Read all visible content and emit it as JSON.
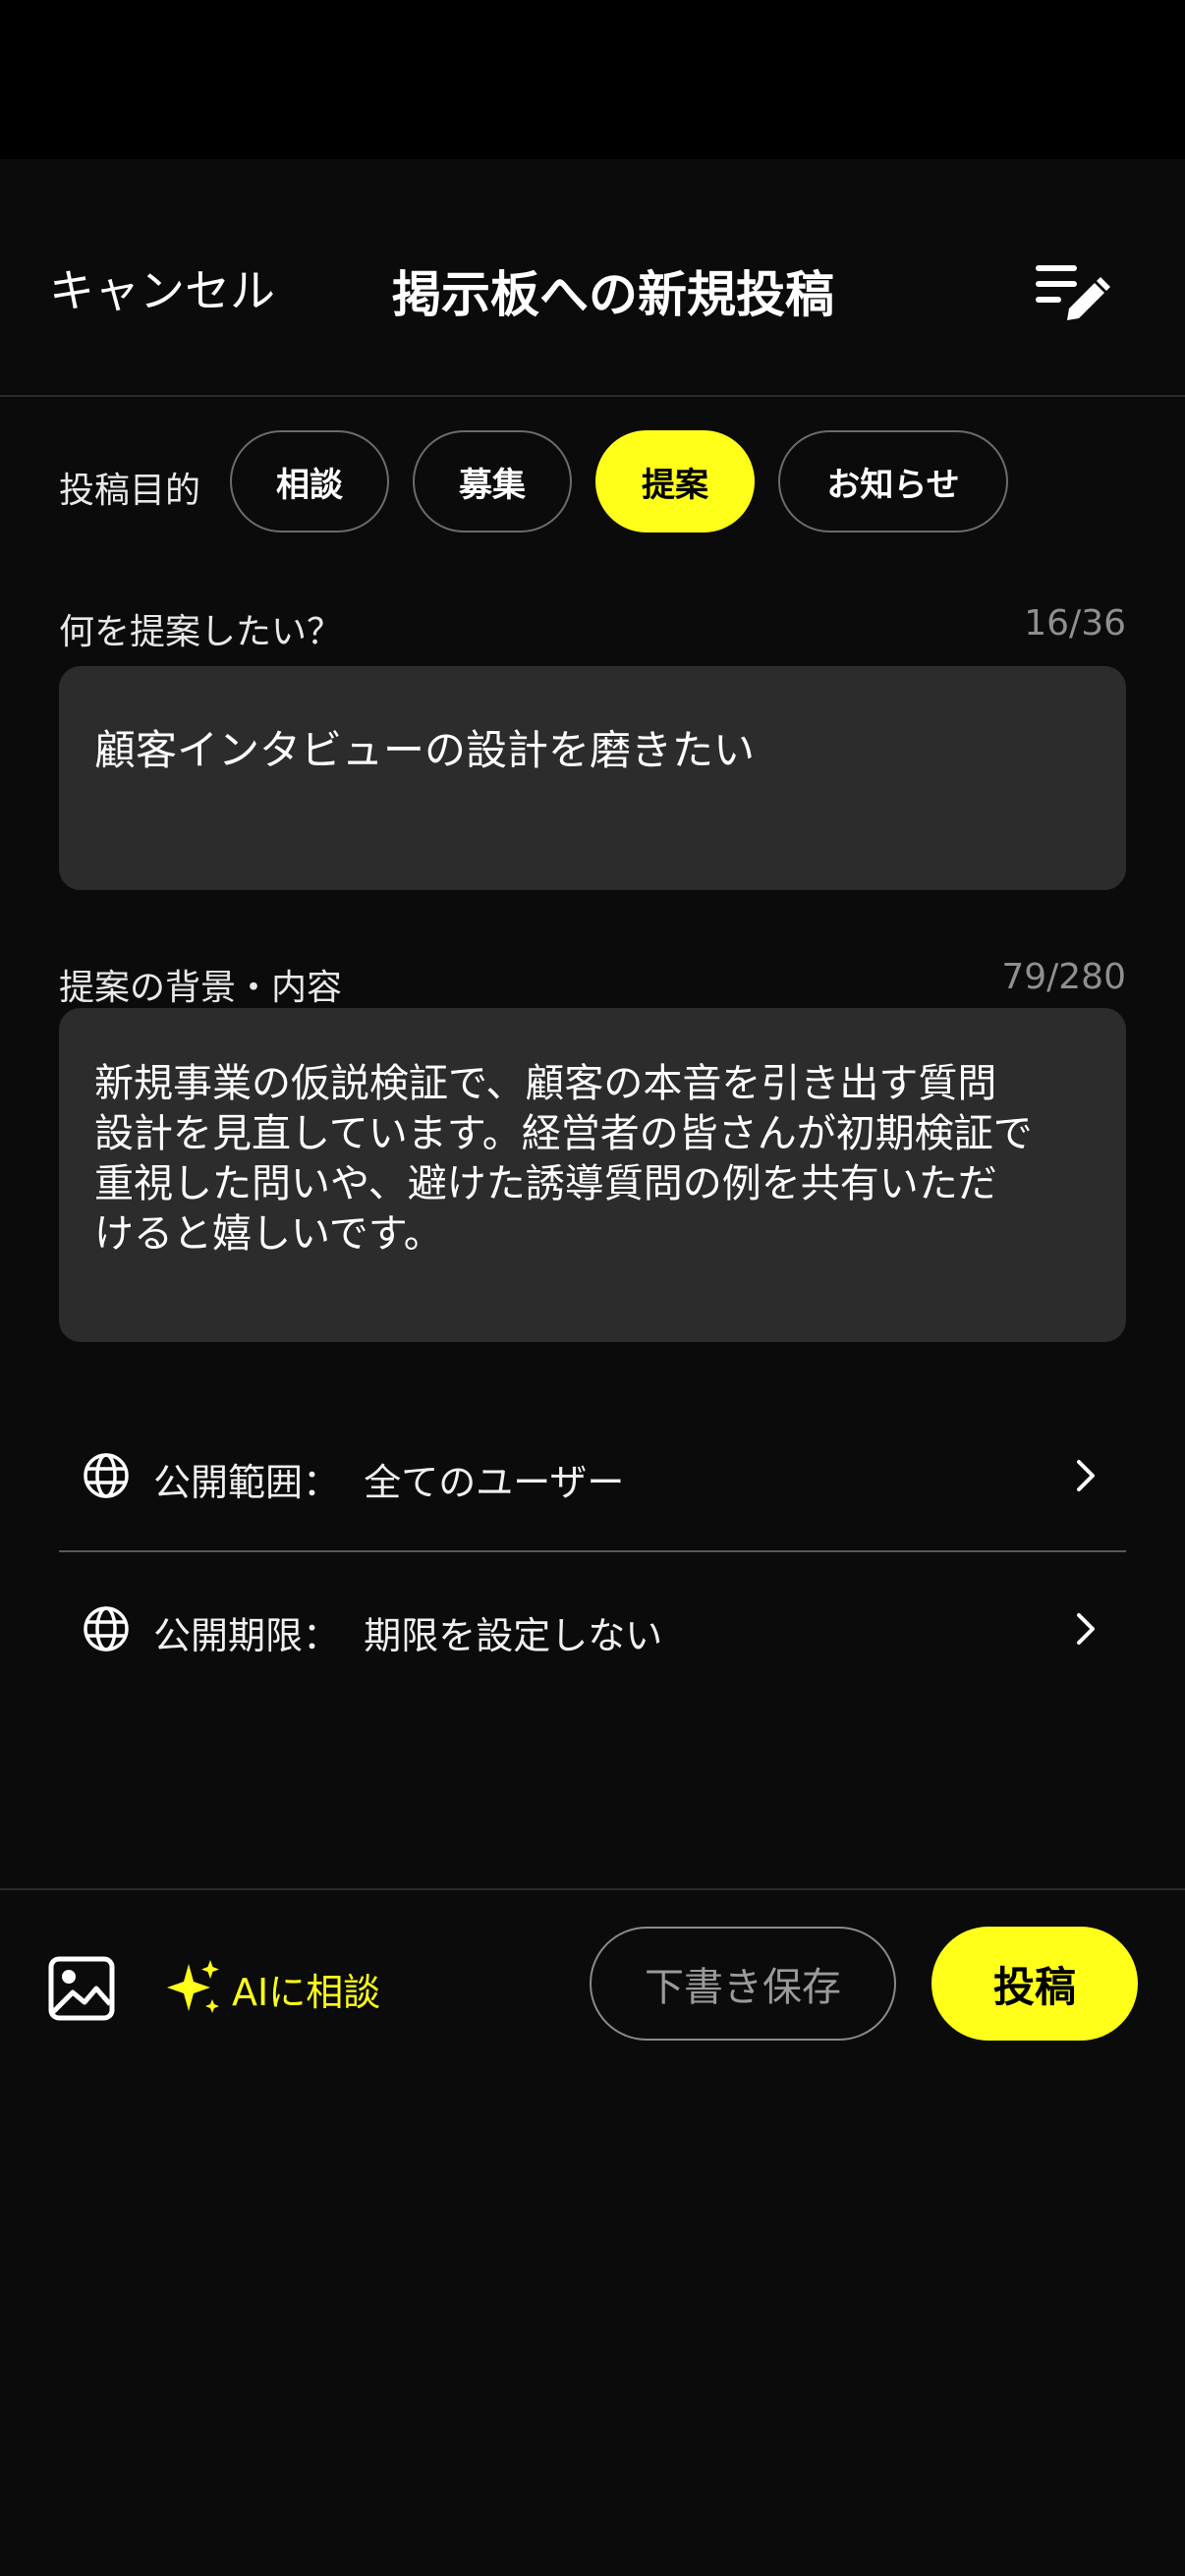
{
  "header": {
    "cancel_label": "キャンセル",
    "title": "掲示板への新規投稿",
    "drafts_icon": "drafts-list-edit-icon"
  },
  "purpose": {
    "label": "投稿目的",
    "chips": [
      {
        "label": "相談",
        "selected": false
      },
      {
        "label": "募集",
        "selected": false
      },
      {
        "label": "提案",
        "selected": true
      },
      {
        "label": "お知らせ",
        "selected": false
      }
    ]
  },
  "title_field": {
    "label": "何を提案したい？",
    "count": "16/36",
    "value": "顧客インタビューの設計を磨きたい"
  },
  "body_field": {
    "label": "提案の背景・内容",
    "count": "79/280",
    "lines": [
      "新規事業の仮説検証で、顧客の本音を引き出す質問",
      "設計を見直しています。経営者の皆さんが初期検証で",
      "重視した問いや、避けた誘導質問の例を共有いただ",
      "けると嬉しいです。"
    ]
  },
  "settings": {
    "visibility": {
      "label": "公開範囲：",
      "value": "全てのユーザー",
      "icon": "globe-icon"
    },
    "expiry": {
      "label": "公開期限：",
      "value": "期限を設定しない",
      "icon": "globe-icon"
    }
  },
  "bottom_bar": {
    "image_icon": "image-icon",
    "ai_label": "AIに相談",
    "ai_icon": "sparkles-icon",
    "draft_label": "下書き保存",
    "post_label": "投稿"
  },
  "colors": {
    "accent": "#ffff1a",
    "background": "#0b0b0b",
    "field_bg": "#2c2c2c"
  }
}
